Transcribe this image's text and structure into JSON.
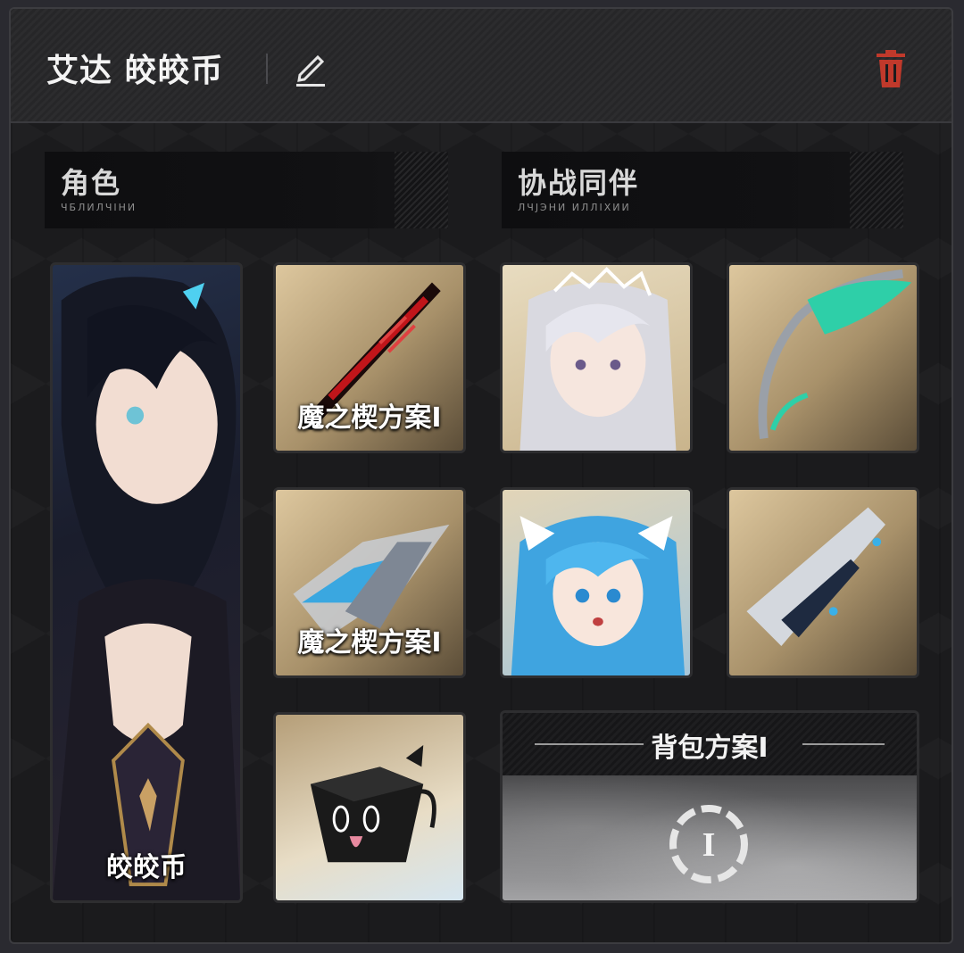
{
  "header": {
    "title": "艾达 皎皎币"
  },
  "sections": {
    "character": {
      "label": "角色",
      "sub": "ЧБЛИЛЧІНИ"
    },
    "partners": {
      "label": "协战同伴",
      "sub": "ЛЧЈЭНИ ИЛЛІХИИ"
    }
  },
  "character_card": {
    "caption": "皎皎币"
  },
  "weapon_cards": [
    {
      "caption": "魔之楔方案Ⅰ"
    },
    {
      "caption": "魔之楔方案Ⅰ"
    }
  ],
  "backpack": {
    "title": "背包方案Ⅰ",
    "icon_text": "I"
  },
  "colors": {
    "accent_red": "#c0392b",
    "card_border": "#2e2e30"
  }
}
